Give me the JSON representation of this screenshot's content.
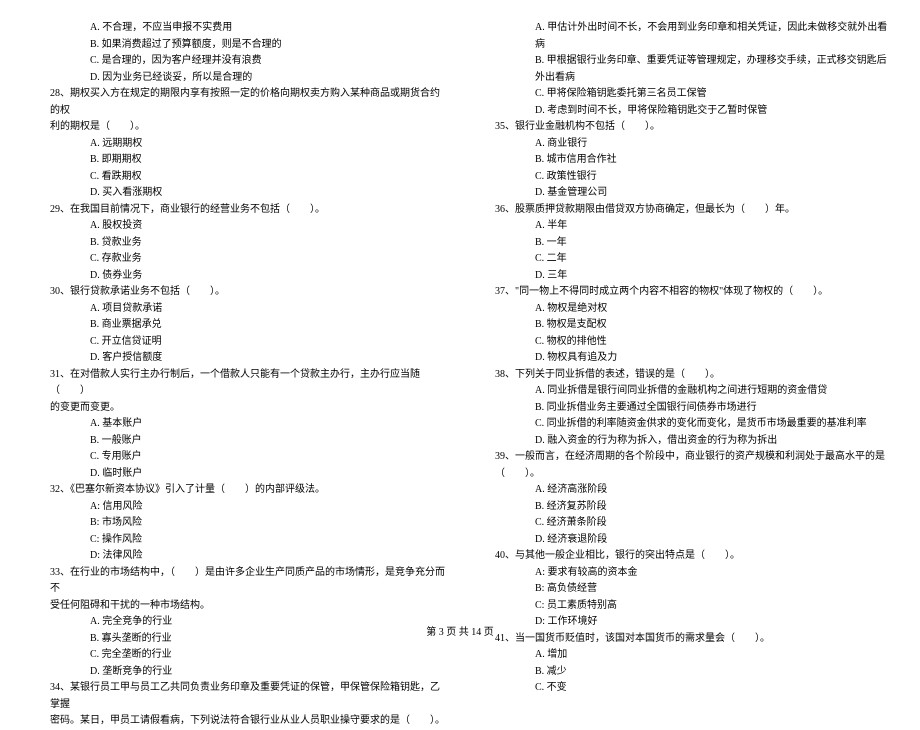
{
  "left_column": {
    "lines": [
      {
        "cls": "option",
        "text": "A. 不合理，不应当申报不实费用"
      },
      {
        "cls": "option",
        "text": "B. 如果消费超过了预算额度，则是不合理的"
      },
      {
        "cls": "option",
        "text": "C. 是合理的，因为客户经理并没有浪费"
      },
      {
        "cls": "option",
        "text": "D. 因为业务已经谈妥，所以是合理的"
      },
      {
        "cls": "question",
        "text": "28、期权买入方在规定的期限内享有按照一定的价格向期权卖方购入某种商品或期货合约的权"
      },
      {
        "cls": "question",
        "text": "利的期权是（　　）。"
      },
      {
        "cls": "option",
        "text": "A. 远期期权"
      },
      {
        "cls": "option",
        "text": "B. 即期期权"
      },
      {
        "cls": "option",
        "text": "C. 看跌期权"
      },
      {
        "cls": "option",
        "text": "D. 买入看涨期权"
      },
      {
        "cls": "question",
        "text": "29、在我国目前情况下，商业银行的经营业务不包括（　　）。"
      },
      {
        "cls": "option",
        "text": "A. 股权投资"
      },
      {
        "cls": "option",
        "text": "B. 贷款业务"
      },
      {
        "cls": "option",
        "text": "C. 存款业务"
      },
      {
        "cls": "option",
        "text": "D. 债券业务"
      },
      {
        "cls": "question",
        "text": "30、银行贷款承诺业务不包括（　　）。"
      },
      {
        "cls": "option",
        "text": "A. 项目贷款承诺"
      },
      {
        "cls": "option",
        "text": "B. 商业票据承兑"
      },
      {
        "cls": "option",
        "text": "C. 开立信贷证明"
      },
      {
        "cls": "option",
        "text": "D. 客户授信额度"
      },
      {
        "cls": "question",
        "text": "31、在对借款人实行主办行制后，一个借款人只能有一个贷款主办行，主办行应当随（　　）"
      },
      {
        "cls": "question",
        "text": "的变更而变更。"
      },
      {
        "cls": "option",
        "text": "A.  基本账户"
      },
      {
        "cls": "option",
        "text": "B.  一般账户"
      },
      {
        "cls": "option",
        "text": "C.  专用账户"
      },
      {
        "cls": "option",
        "text": "D.  临时账户"
      },
      {
        "cls": "question",
        "text": "32、《巴塞尔新资本协议》引入了计量（　　）的内部评级法。"
      },
      {
        "cls": "option",
        "text": "A: 信用风险"
      },
      {
        "cls": "option",
        "text": "B: 市场风险"
      },
      {
        "cls": "option",
        "text": "C: 操作风险"
      },
      {
        "cls": "option",
        "text": "D: 法律风险"
      },
      {
        "cls": "question",
        "text": "33、在行业的市场结构中，（　　）是由许多企业生产同质产品的市场情形，是竞争充分而不"
      },
      {
        "cls": "question",
        "text": "受任何阻碍和干扰的一种市场结构。"
      },
      {
        "cls": "option",
        "text": "A.  完全竞争的行业"
      },
      {
        "cls": "option",
        "text": "B.  寡头垄断的行业"
      },
      {
        "cls": "option",
        "text": "C.  完全垄断的行业"
      },
      {
        "cls": "option",
        "text": "D.  垄断竞争的行业"
      },
      {
        "cls": "question",
        "text": "34、某银行员工甲与员工乙共同负责业务印章及重要凭证的保管，甲保管保险箱钥匙，乙掌握"
      },
      {
        "cls": "question",
        "text": "密码。某日，甲员工请假看病，下列说法符合银行业从业人员职业操守要求的是（　　）。"
      }
    ]
  },
  "right_column": {
    "lines": [
      {
        "cls": "option",
        "text": "A. 甲估计外出时间不长，不会用到业务印章和相关凭证，因此未做移交就外出看病"
      },
      {
        "cls": "option",
        "text": "B. 甲根据银行业务印章、重要凭证等管理规定，办理移交手续，正式移交钥匙后外出看病"
      },
      {
        "cls": "option",
        "text": "C. 甲将保险箱钥匙委托第三名员工保管"
      },
      {
        "cls": "option",
        "text": "D. 考虑到时间不长，甲将保险箱钥匙交于乙暂时保管"
      },
      {
        "cls": "question",
        "text": "35、银行业金融机构不包括（　　）。"
      },
      {
        "cls": "option",
        "text": "A.  商业银行"
      },
      {
        "cls": "option",
        "text": "B.  城市信用合作社"
      },
      {
        "cls": "option",
        "text": "C.  政策性银行"
      },
      {
        "cls": "option",
        "text": "D.  基金管理公司"
      },
      {
        "cls": "question",
        "text": "36、股票质押贷款期限由借贷双方协商确定，但最长为（　　）年。"
      },
      {
        "cls": "option",
        "text": "A.  半年"
      },
      {
        "cls": "option",
        "text": "B.  一年"
      },
      {
        "cls": "option",
        "text": "C.  二年"
      },
      {
        "cls": "option",
        "text": "D.  三年"
      },
      {
        "cls": "question",
        "text": "37、\"同一物上不得同时成立两个内容不相容的物权\"体现了物权的（　　）。"
      },
      {
        "cls": "option",
        "text": "A. 物权是绝对权"
      },
      {
        "cls": "option",
        "text": "B. 物权是支配权"
      },
      {
        "cls": "option",
        "text": "C. 物权的排他性"
      },
      {
        "cls": "option",
        "text": "D. 物权具有追及力"
      },
      {
        "cls": "question",
        "text": "38、下列关于同业拆借的表述，错误的是（　　）。"
      },
      {
        "cls": "option",
        "text": "A. 同业拆借是银行间同业拆借的金融机构之间进行短期的资金借贷"
      },
      {
        "cls": "option",
        "text": "B. 同业拆借业务主要通过全国银行间债券市场进行"
      },
      {
        "cls": "option",
        "text": "C. 同业拆借的利率随资金供求的变化而变化，是货币市场最重要的基准利率"
      },
      {
        "cls": "option",
        "text": "D. 融入资金的行为称为拆入，借出资金的行为称为拆出"
      },
      {
        "cls": "question",
        "text": "39、一般而言，在经济周期的各个阶段中，商业银行的资产规模和利润处于最高水平的是"
      },
      {
        "cls": "question",
        "text": "（　　）。"
      },
      {
        "cls": "option",
        "text": "A. 经济高涨阶段"
      },
      {
        "cls": "option",
        "text": "B. 经济复苏阶段"
      },
      {
        "cls": "option",
        "text": "C. 经济萧条阶段"
      },
      {
        "cls": "option",
        "text": "D. 经济衰退阶段"
      },
      {
        "cls": "question",
        "text": "40、与其他一般企业相比，银行的突出特点是（　　）。"
      },
      {
        "cls": "option",
        "text": "A: 要求有较高的资本金"
      },
      {
        "cls": "option",
        "text": "B: 高负债经营"
      },
      {
        "cls": "option",
        "text": "C: 员工素质特别高"
      },
      {
        "cls": "option",
        "text": "D: 工作环境好"
      },
      {
        "cls": "question",
        "text": "41、当一国货币贬值时，该国对本国货币的需求量会（　　）。"
      },
      {
        "cls": "option",
        "text": "A. 增加"
      },
      {
        "cls": "option",
        "text": "B. 减少"
      },
      {
        "cls": "option",
        "text": "C. 不变"
      }
    ]
  },
  "footer": "第 3 页 共 14 页"
}
